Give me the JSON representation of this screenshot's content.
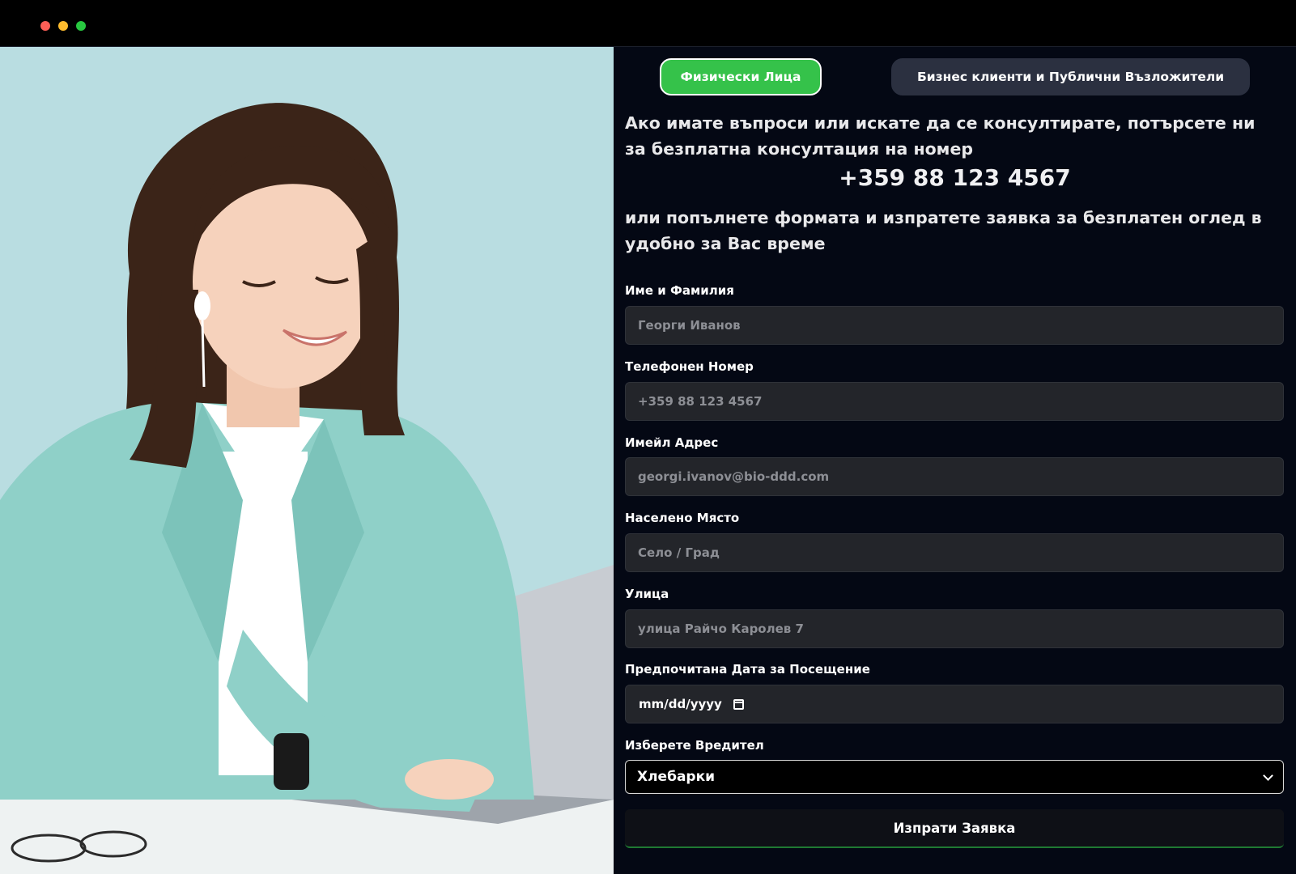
{
  "tabs": {
    "individuals": "Физически Лица",
    "business": "Бизнес клиенти и Публични Възложители"
  },
  "intro": {
    "line1": "Ако имате въпроси или искате да се консултирате, потърсете ни за безплатна консултация на номер",
    "phone": "+359 88 123 4567",
    "line2": "или попълнете формата и изпратете заявка за безплатен оглед в удобно за Вас време"
  },
  "form": {
    "name_label": "Име и Фамилия",
    "name_placeholder": "Георги Иванов",
    "phone_label": "Телефонен Номер",
    "phone_placeholder": "+359 88 123 4567",
    "email_label": "Имейл Адрес",
    "email_placeholder": "georgi.ivanov@bio-ddd.com",
    "city_label": "Населено Място",
    "city_placeholder": "Село / Град",
    "street_label": "Улица",
    "street_placeholder": "улица Райчо Каролев 7",
    "date_label": "Предпочитана Дата за Посещение",
    "date_placeholder": "mm/dd/yyyy",
    "pest_label": "Изберете Вредител",
    "pest_selected": "Хлебарки",
    "submit_label": "Изпрати Заявка"
  },
  "colors": {
    "accent": "#35c24a",
    "panel_bg": "#040814",
    "field_bg": "#23252a"
  }
}
